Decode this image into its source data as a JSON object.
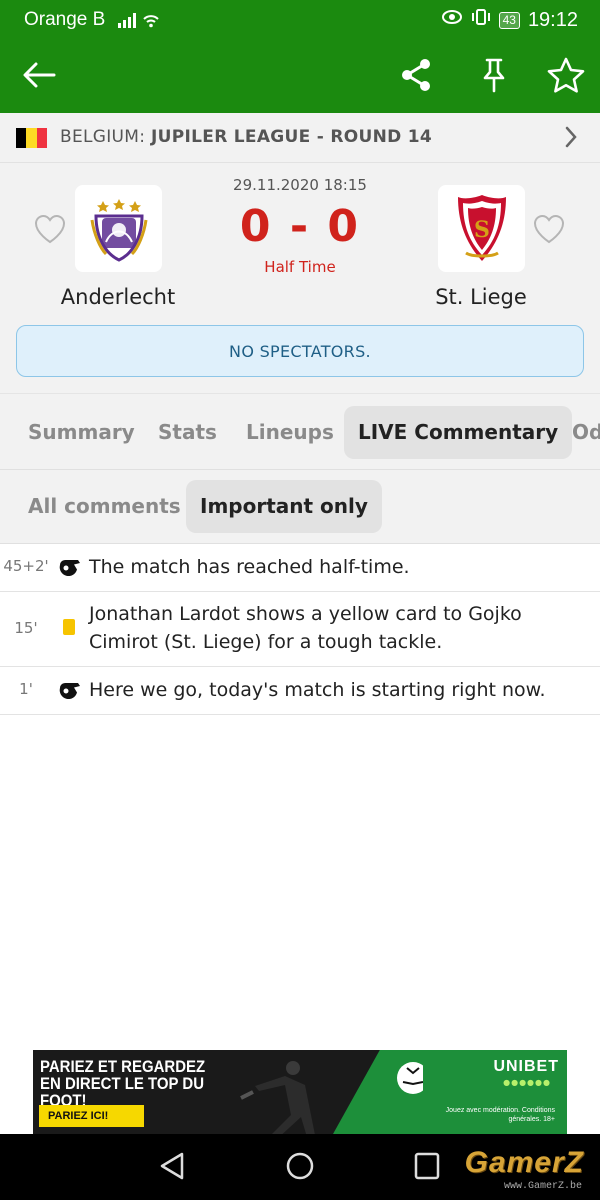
{
  "status_bar": {
    "carrier": "Orange B",
    "battery": "43",
    "time": "19:12"
  },
  "toolbar": {
    "back_icon": "arrow-left-icon",
    "share_icon": "share-icon",
    "pin_icon": "pin-icon",
    "favorite_icon": "star-icon"
  },
  "league": {
    "country": "BELGIUM:",
    "name": "JUPILER LEAGUE - ROUND 14",
    "flag_colors": [
      "#000000",
      "#fdda24",
      "#ef3340"
    ]
  },
  "match": {
    "datetime": "29.11.2020 18:15",
    "score": "0 - 0",
    "status": "Half Time",
    "home_team": "Anderlecht",
    "away_team": "St. Liege",
    "notice": "NO SPECTATORS.",
    "score_color": "#d0231c"
  },
  "tabs": [
    {
      "label": "Summary",
      "active": false
    },
    {
      "label": "Stats",
      "active": false
    },
    {
      "label": "Lineups",
      "active": false
    },
    {
      "label": "LIVE Commentary",
      "active": true
    },
    {
      "label": "Od",
      "active": false
    }
  ],
  "filters": [
    {
      "label": "All comments",
      "active": false
    },
    {
      "label": "Important only",
      "active": true
    }
  ],
  "comments": [
    {
      "minute": "45+2'",
      "icon": "whistle-icon",
      "text": "The match has reached half-time."
    },
    {
      "minute": "15'",
      "icon": "yellow-card-icon",
      "text": "Jonathan Lardot shows a yellow card to Gojko Cimirot (St. Liege) for a tough tackle."
    },
    {
      "minute": "1'",
      "icon": "whistle-icon",
      "text": "Here we go, today's match is starting right now."
    }
  ],
  "ad": {
    "headline": "PARIEZ ET REGARDEZ EN DIRECT LE TOP DU FOOT!",
    "cta": "PARIEZ ICI!",
    "brand": "UNIBET",
    "fine_print": "Jouez avec modération. Conditions générales. 18+"
  },
  "watermark": {
    "title": "GamerZ",
    "url": "www.GamerZ.be"
  }
}
